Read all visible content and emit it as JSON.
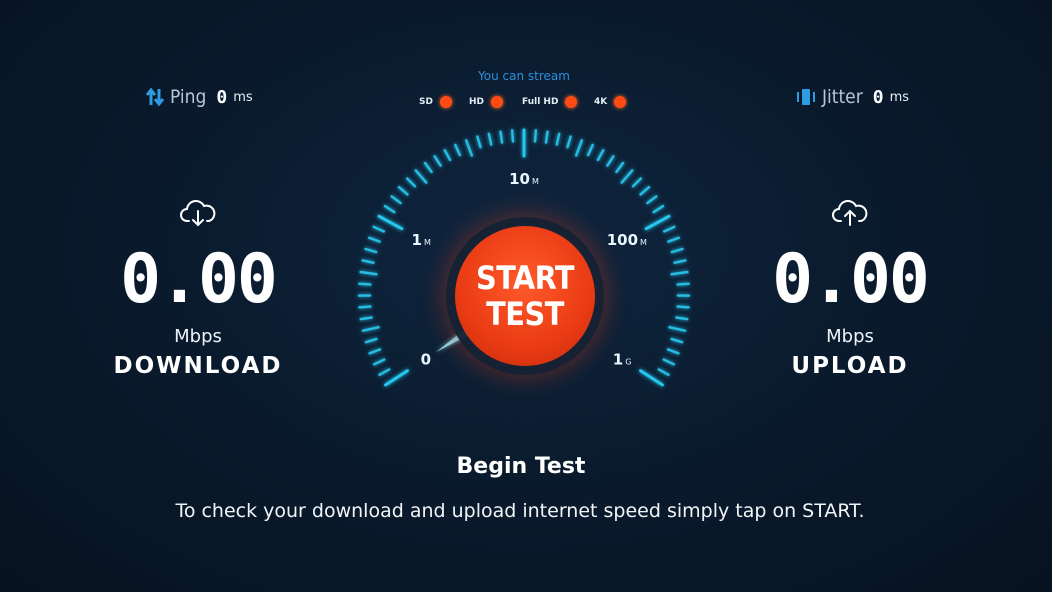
{
  "ping": {
    "label": "Ping",
    "value": "0",
    "unit": "ms"
  },
  "jitter": {
    "label": "Jitter",
    "value": "0",
    "unit": "ms"
  },
  "stream": {
    "title": "You can stream",
    "qualities": [
      {
        "label": "SD"
      },
      {
        "label": "HD"
      },
      {
        "label": "Full HD"
      },
      {
        "label": "4K"
      }
    ]
  },
  "gauge": {
    "labels": [
      {
        "text": "0",
        "suffix": ""
      },
      {
        "text": "1",
        "suffix": "M"
      },
      {
        "text": "10",
        "suffix": "M"
      },
      {
        "text": "100",
        "suffix": "M"
      },
      {
        "text": "1",
        "suffix": "G"
      }
    ],
    "needle_fraction": 0
  },
  "start_button": {
    "line1": "START",
    "line2": "TEST"
  },
  "download": {
    "value": "0.00",
    "unit": "Mbps",
    "caption": "DOWNLOAD"
  },
  "upload": {
    "value": "0.00",
    "unit": "Mbps",
    "caption": "UPLOAD"
  },
  "begin": {
    "title": "Begin Test",
    "description": "To check your download and upload internet speed simply tap on START."
  },
  "colors": {
    "accent": "#27c7ee",
    "start": "#ea3b14",
    "quality_dot": "#ff4a12",
    "stream_title": "#2d8fd8"
  },
  "icons": {
    "ping": "ping-arrows-icon",
    "jitter": "jitter-icon",
    "download": "cloud-download-icon",
    "upload": "cloud-upload-icon"
  }
}
